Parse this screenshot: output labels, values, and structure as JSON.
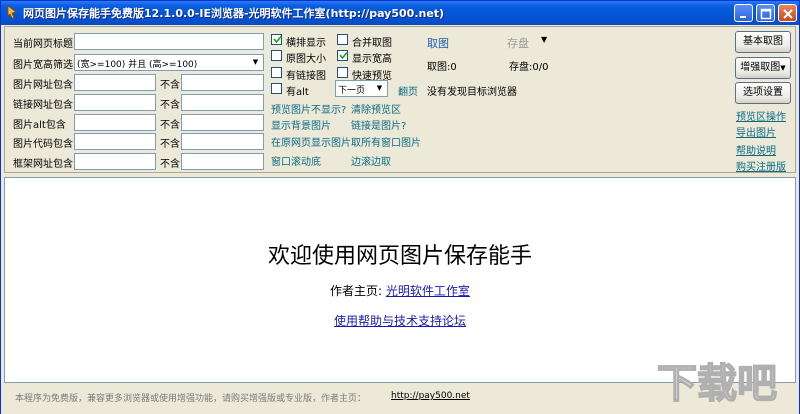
{
  "window": {
    "title": "网页图片保存能手免费版12.1.0.0-IE浏览器-光明软件工作室(http://pay500.net)"
  },
  "filters": {
    "page_title_label": "当前网页标题",
    "size_filter_label": "图片宽高筛选",
    "size_filter_value": "(宽>=100) 并且 (高>=100)",
    "url_include_label": "图片网址包含",
    "link_include_label": "链接网址包含",
    "alt_include_label": "图片alt包含",
    "code_include_label": "图片代码包含",
    "frame_include_label": "框架网址包含",
    "exclude_label": "不含"
  },
  "options": {
    "horizontal": "横排显示",
    "merge": "合并取图",
    "original_size": "原图大小",
    "show_size": "显示宽高",
    "has_link": "有链接图",
    "quick_preview": "快速预览",
    "has_alt": "有alt",
    "page_select": "下一页",
    "flip_page": "翻页"
  },
  "links": {
    "preview_not_shown": "预览图片不显示?",
    "clear_preview": "清除预览区",
    "show_bg": "显示背景图片",
    "link_is_image": "链接是图片?",
    "show_in_original": "在原网页显示图片",
    "all_window_images": "取所有窗口图片",
    "window_scroll": "窗口滚动底",
    "scroll_fetch": "边滚边取"
  },
  "fetch": {
    "title": "取图",
    "save_disk": "存盘",
    "fetch_count": "取图:0",
    "save_count": "存盘:0/0",
    "status": "没有发现目标浏览器"
  },
  "side": {
    "basic_fetch": "基本取图",
    "enhanced_fetch": "增强取图",
    "options": "选项设置",
    "preview_ops": "预览区操作",
    "export": "导出图片",
    "help": "帮助说明",
    "buy": "购买注册版"
  },
  "content": {
    "welcome": "欢迎使用网页图片保存能手",
    "author_prefix": "作者主页:",
    "author_link": "光明软件工作室",
    "help_link": "使用帮助与技术支持论坛"
  },
  "status": {
    "text": "本程序为免费版，兼容更多浏览器或使用增强功能，请购买增强版或专业版，作者主页：",
    "url": "http://pay500.net"
  },
  "watermark": {
    "text": "下载吧"
  },
  "colors": {
    "titlebar": "#0454d6",
    "link": "#0a6c84",
    "accent_blue": "#1a5fb4"
  }
}
